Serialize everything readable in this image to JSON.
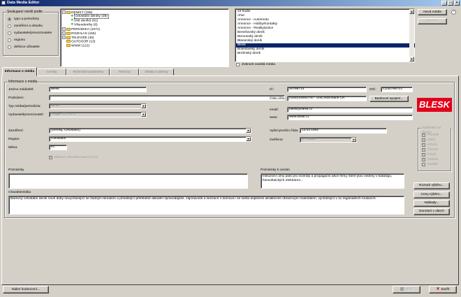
{
  "window": {
    "title": "Data Media Editor",
    "controls": {
      "minimize": "_",
      "maximize": "□",
      "close": "×"
    }
  },
  "sort_group": {
    "title": "Seskupení médií podle",
    "options": [
      {
        "label": "typu a periodicity",
        "selected": true
      },
      {
        "label": "zaměření a obsahu",
        "selected": false
      },
      {
        "label": "vydavatele/provozovatele",
        "selected": false
      },
      {
        "label": "regionu",
        "selected": false
      },
      {
        "label": "definice uživatele",
        "selected": false
      }
    ]
  },
  "tree": {
    "items": [
      {
        "label": "DENÍKY (155)",
        "level": 0,
        "expander": "−"
      },
      {
        "label": "celostátní deníky (38)",
        "level": 1,
        "selected": true
      },
      {
        "label": "Sítě deníků (91)",
        "level": 1
      },
      {
        "label": "Víkendeníky (6)",
        "level": 1
      },
      {
        "label": "PERIODIKA (1071)",
        "level": 0,
        "expander": "+"
      },
      {
        "label": "ROZHLAS (155)",
        "level": 0,
        "expander": "+"
      },
      {
        "label": "TELEVIZE (45)",
        "level": 0,
        "expander": "+"
      },
      {
        "label": "OUTDOOR (13)",
        "level": 0,
        "expander": ""
      },
      {
        "label": "WWW (122)",
        "level": 0,
        "expander": ""
      }
    ]
  },
  "media_list": {
    "items": [
      {
        "label": "24 hodin"
      },
      {
        "label": "Aha!"
      },
      {
        "label": "Annonce - Auto/moto"
      },
      {
        "label": "Annonce - Hobby/Kontakty"
      },
      {
        "label": "Annonce - Reality/práce"
      },
      {
        "label": "Benešovský deník"
      },
      {
        "label": "Berounský deník"
      },
      {
        "label": "Blanenský deník"
      },
      {
        "label": "Blesk",
        "selected": true
      },
      {
        "label": "Boleslavský deník"
      },
      {
        "label": "Brněnský deník"
      }
    ],
    "scroll_up": "▲",
    "scroll_down": "▼",
    "show_unused_label": "Zobrazit zaniklá média"
  },
  "side_buttons": {
    "new_media": "Nová média",
    "delete": "Smazat"
  },
  "help_icon": "help-icon",
  "tabs": [
    {
      "label": "Informace o médiu",
      "active": true
    },
    {
      "label": "Ceníky"
    },
    {
      "label": "Technické parametry"
    },
    {
      "label": "Termíny"
    },
    {
      "label": "Dėlaty a adresy"
    }
  ],
  "info_group": {
    "title": "Informace o médiu"
  },
  "form": {
    "name_label": "Jméno média/titl:",
    "name_value": "Blesk",
    "subtitle_label": "Podnázev:",
    "subtitle_value": "",
    "type_label": "Typ média/periodicita:",
    "type_value": "deník",
    "publisher_label": "Vydavatel/provozovatel:",
    "publisher_value": "Ringier ČR, a. s.",
    "ic_label": "IČ:",
    "ic_value": "40766713",
    "dic_label": "DIČ:",
    "dic_value": "CZ40766713",
    "account_label": "Číslo účtu:",
    "account_value": "0154019082700 - UniCredit Bank ČR",
    "bank_button": "Bankovní spojení...",
    "email_label": "email:",
    "email_value": "blesk@blesk.cz",
    "www_label": "www:",
    "www_value": "www.blesk.cz",
    "focus_label": "Zaměření:",
    "focus_value": "(Deníky, Celostátní)",
    "region_label": "Region:",
    "region_value": "Celostátní",
    "currency_label": "Měna:",
    "currency_value": "Kč",
    "media_check_label": "Médium aktualizované firmou",
    "first_issue_label": "Vyšel prvního čísla:",
    "first_issue_value": "13.04.1992",
    "verified_label": "Ověřeno:",
    "verified_value": "1. 1.2000",
    "combo_arrow": "▼"
  },
  "logo_text": "BLESK",
  "print_group": {
    "title": "Vydávání ve dnech",
    "days": [
      {
        "label": "Pondělí",
        "checked": true
      },
      {
        "label": "Úterý",
        "checked": true
      },
      {
        "label": "Středa",
        "checked": true
      },
      {
        "label": "Čtvrtek",
        "checked": true
      },
      {
        "label": "Pátek",
        "checked": true
      },
      {
        "label": "Sobota",
        "checked": true
      },
      {
        "label": "Neděle",
        "checked": false
      }
    ]
  },
  "notes": {
    "label": "Poznámky",
    "value": "",
    "price_notes_label": "Poznámky k cenám",
    "price_notes_value": "Inkluzivní ceny platí pro inzeráty a propagační akce firmy, které jsou vedeny v katalogu, fotovoltaických elektráren..."
  },
  "characteristics": {
    "label": "Charakteristika",
    "value": "Barevný celostátní deník nové doby nevycházející se žádným tématem a přinášející přehledné aktuální zpravodajství, zajímavosti a senzace z domova i ze světa doplněné atraktivním obrazovým materiálem, vycházející v 11 regionálních mutacích."
  },
  "right_buttons": {
    "print_choice": "Rozsah výběru...",
    "price_choice": "Ceny výběru...",
    "costs": "Náklady...",
    "attendance": "Dorostní v oltech"
  },
  "footer": {
    "new_assess_button": "Nález hodnocení...",
    "save_button": "Uložit",
    "close_button": "Zavřít"
  }
}
